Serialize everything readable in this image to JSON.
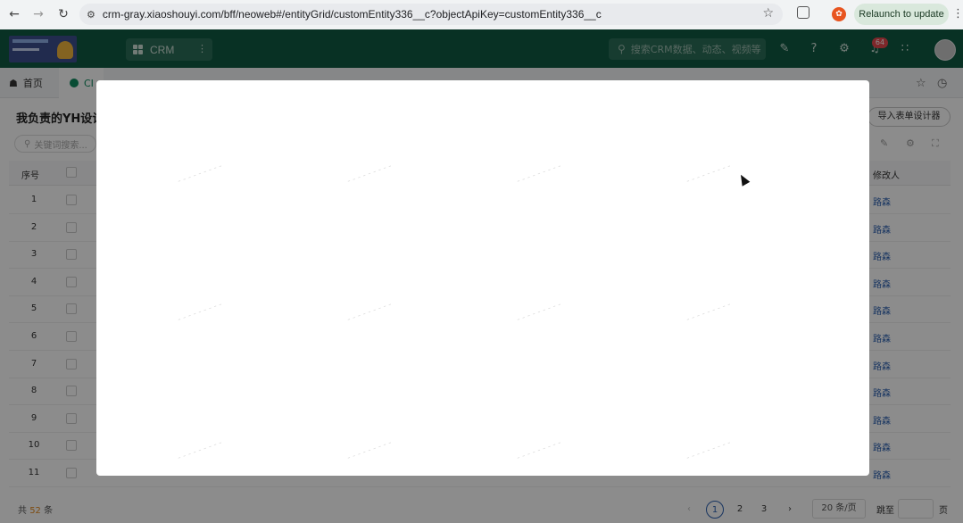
{
  "browser": {
    "url": "crm-gray.xiaoshouyi.com/bff/neoweb#/entityGrid/customEntity336__c?objectApiKey=customEntity336__c",
    "relaunch_label": "Relaunch to update"
  },
  "header": {
    "app_switch_label": "CRM",
    "search_placeholder": "搜索CRM数据、动态、视频等",
    "notification_count": "64"
  },
  "tabs": {
    "home_label": "首页",
    "active_label": "CI"
  },
  "page": {
    "title": "我负责的YH设计",
    "import_button": "导入表单设计器",
    "keyword_search_placeholder": "关键词搜索..."
  },
  "table": {
    "headers": {
      "index": "序号",
      "modifier": "修改人"
    },
    "rows": [
      {
        "index": "1",
        "modifier": "路森"
      },
      {
        "index": "2",
        "modifier": "路森"
      },
      {
        "index": "3",
        "modifier": "路森"
      },
      {
        "index": "4",
        "modifier": "路森"
      },
      {
        "index": "5",
        "modifier": "路森"
      },
      {
        "index": "6",
        "modifier": "路森"
      },
      {
        "index": "7",
        "modifier": "路森"
      },
      {
        "index": "8",
        "modifier": "路森"
      },
      {
        "index": "9",
        "modifier": "路森"
      },
      {
        "index": "10",
        "modifier": "路森"
      },
      {
        "index": "11",
        "modifier": "路森"
      }
    ]
  },
  "footer": {
    "total_prefix": "共",
    "total_count": "52",
    "total_suffix": "条",
    "pages": [
      "1",
      "2",
      "3"
    ],
    "page_size": "20 条/页",
    "jump_label": "跳至",
    "jump_unit": "页"
  },
  "icons": {
    "back": "back-arrow-icon",
    "forward": "forward-arrow-icon",
    "reload": "reload-icon",
    "star": "star-icon",
    "history": "history-icon"
  },
  "colors": {
    "header_bg": "#0f5a43",
    "accent": "#0f8a5f",
    "link": "#2a5fb0",
    "overlay": "rgba(0,0,0,0.45)"
  }
}
